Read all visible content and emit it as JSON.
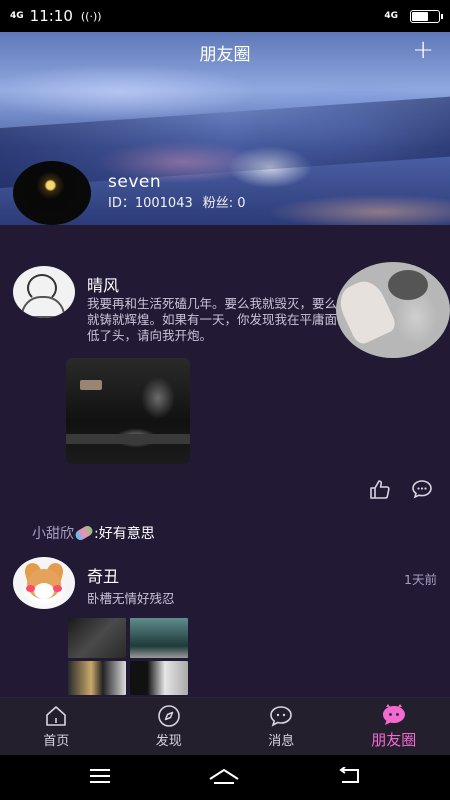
{
  "status_bar": {
    "signal": "4G",
    "time": "11:10",
    "right_signal": "4G"
  },
  "header": {
    "title": "朋友圈",
    "add_label": "+"
  },
  "profile": {
    "name": "seven",
    "id_text": "ID：1001043",
    "fans_text": "粉丝: 0"
  },
  "posts": [
    {
      "author": "晴风",
      "text": "我要再和生活死磕几年。要么我就毁灭，要么我就铸就辉煌。如果有一天，你发现我在平庸面前低了头，请向我开炮。"
    },
    {
      "author": "奇丑",
      "time": "1天前",
      "text": "卧槽无情好残忍"
    }
  ],
  "comment": {
    "user": "小甜欣",
    "text": ":好有意思"
  },
  "tabs": [
    {
      "label": "首页",
      "icon": "home-icon"
    },
    {
      "label": "发现",
      "icon": "compass-icon"
    },
    {
      "label": "消息",
      "icon": "chat-icon"
    },
    {
      "label": "朋友圈",
      "icon": "moments-icon"
    }
  ],
  "colors": {
    "background": "#221a35",
    "active_tab": "#f46ad1",
    "secondary_text": "#a79ebb"
  }
}
